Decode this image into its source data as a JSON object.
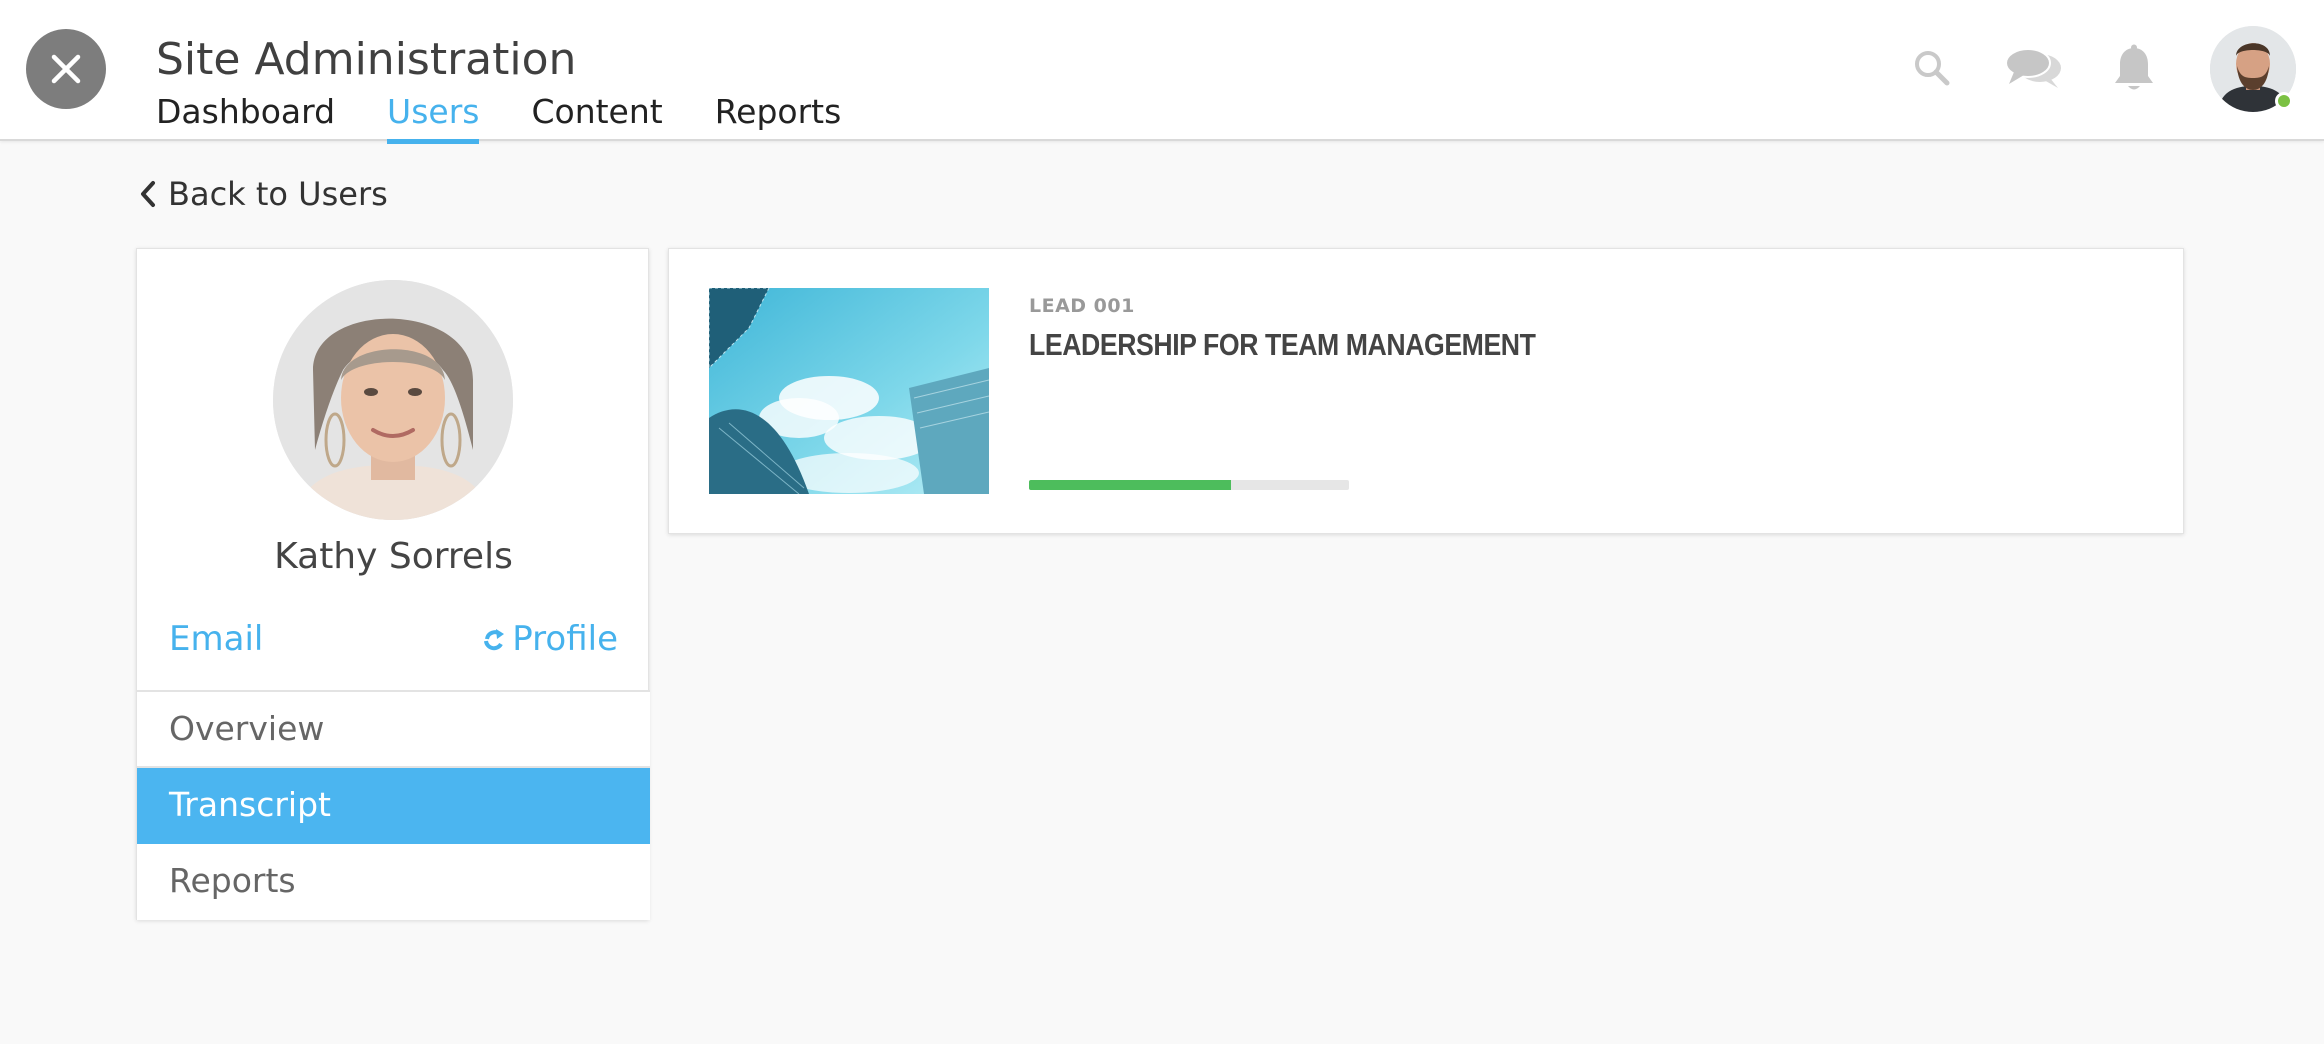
{
  "header": {
    "title": "Site Administration",
    "close_icon": "close-icon",
    "nav": [
      {
        "label": "Dashboard",
        "active": false
      },
      {
        "label": "Users",
        "active": true
      },
      {
        "label": "Content",
        "active": false
      },
      {
        "label": "Reports",
        "active": false
      }
    ],
    "icons": [
      "search-icon",
      "chat-icon",
      "bell-icon"
    ],
    "user_status": "online"
  },
  "back_link": {
    "label": "Back to Users"
  },
  "profile": {
    "name": "Kathy Sorrels",
    "email_label": "Email",
    "profile_label": "Profile",
    "menu": [
      {
        "label": "Overview",
        "active": false
      },
      {
        "label": "Transcript",
        "active": true
      },
      {
        "label": "Reports",
        "active": false
      }
    ]
  },
  "courses": [
    {
      "code": "LEAD 001",
      "title": "LEADERSHIP FOR TEAM MANAGEMENT",
      "progress": 0.63
    }
  ],
  "colors": {
    "accent": "#46b2ed",
    "progress": "#4dbd5c",
    "online": "#7bc143"
  }
}
